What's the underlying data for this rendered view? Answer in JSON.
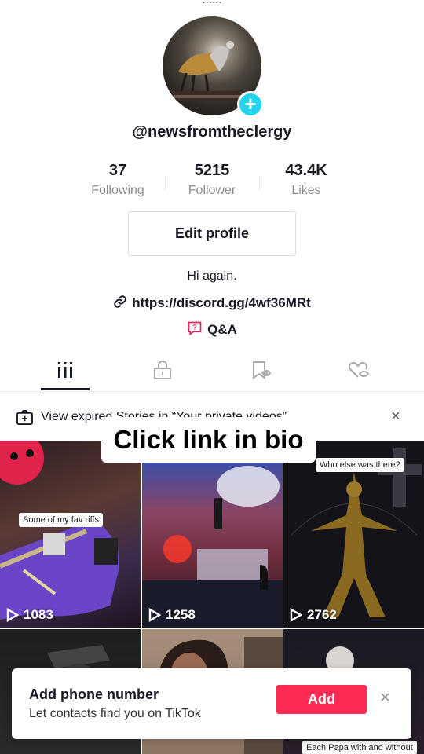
{
  "top_cut_text": "......",
  "profile": {
    "username": "@newsfromtheclergy",
    "bio": "Hi again.",
    "link": "https://discord.gg/4wf36MRt",
    "qa_label": "Q&A"
  },
  "stats": [
    {
      "value": "37",
      "label": "Following"
    },
    {
      "value": "5215",
      "label": "Follower"
    },
    {
      "value": "43.4K",
      "label": "Likes"
    }
  ],
  "edit_profile_label": "Edit profile",
  "tabs": [
    {
      "icon": "grid-icon",
      "active": true
    },
    {
      "icon": "lock-icon",
      "active": false
    },
    {
      "icon": "bookmark-icon",
      "active": false
    },
    {
      "icon": "heart-hidden-icon",
      "active": false
    }
  ],
  "notice": {
    "text": "View expired Stories in “Your private videos”"
  },
  "overlay_caption": "Click link in bio",
  "videos": [
    {
      "views": "1083",
      "tag": "Some of my fav riffs"
    },
    {
      "views": "1258",
      "tag": ""
    },
    {
      "views": "2762",
      "tag": "Who else was there?"
    },
    {
      "views": "",
      "tag": ""
    },
    {
      "views": "",
      "tag": ""
    },
    {
      "views": "",
      "tag": "Each Papa with and without"
    }
  ],
  "toast": {
    "title": "Add phone number",
    "subtitle": "Let contacts find you on TikTok",
    "add_label": "Add"
  },
  "colors": {
    "accent": "#fe2c55",
    "plus_badge": "#20d5ec",
    "text": "#161823",
    "muted": "#8a8b91"
  }
}
